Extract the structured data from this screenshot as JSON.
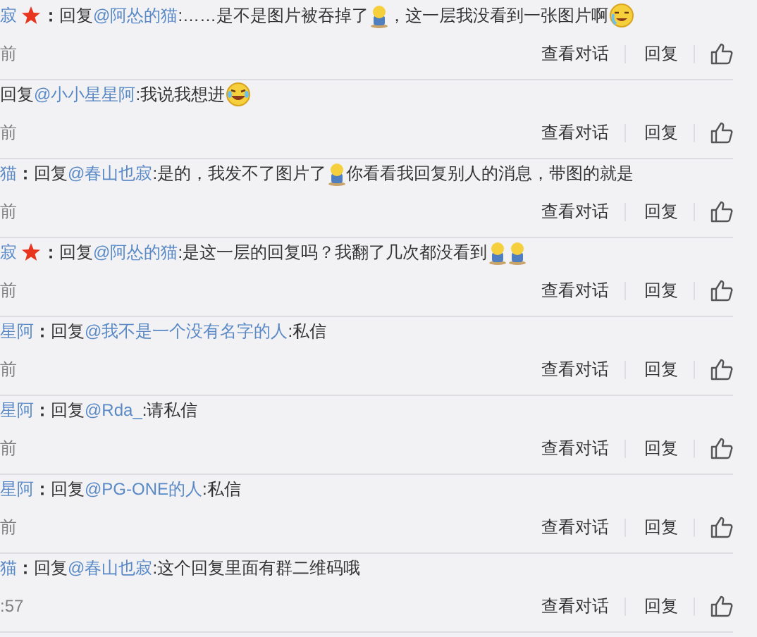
{
  "comments": [
    {
      "author": "寂",
      "starred": true,
      "separator": "：",
      "reply_label": "回复",
      "mention": "@阿怂的猫",
      "body": [
        {
          "kind": "text",
          "text": ":……是不是图片被吞掉了"
        },
        {
          "kind": "figure"
        },
        {
          "kind": "text",
          "text": "，这一层我没看到一张图片啊"
        },
        {
          "kind": "sob"
        }
      ],
      "time": "前",
      "actions": [
        "查看对话",
        "回复"
      ]
    },
    {
      "starred": false,
      "reply_label": "回复",
      "mention": "@小小星星阿",
      "body": [
        {
          "kind": "text",
          "text": ":我说我想进"
        },
        {
          "kind": "laugh"
        }
      ],
      "time": "前",
      "actions": [
        "查看对话",
        "回复"
      ]
    },
    {
      "author": "猫",
      "starred": false,
      "separator": "：",
      "reply_label": "回复",
      "mention": "@春山也寂",
      "body": [
        {
          "kind": "text",
          "text": ":是的，我发不了图片了"
        },
        {
          "kind": "figure"
        },
        {
          "kind": "text",
          "text": " 你看看我回复别人的消息，带图的就是"
        }
      ],
      "time": "前",
      "actions": [
        "查看对话",
        "回复"
      ]
    },
    {
      "author": "寂",
      "starred": true,
      "separator": "：",
      "reply_label": "回复",
      "mention": "@阿怂的猫",
      "body": [
        {
          "kind": "text",
          "text": ":是这一层的回复吗？我翻了几次都没看到"
        },
        {
          "kind": "figure"
        },
        {
          "kind": "figure"
        }
      ],
      "time": "前",
      "actions": [
        "查看对话",
        "回复"
      ]
    },
    {
      "author": "星阿",
      "starred": false,
      "separator": "：",
      "reply_label": "回复",
      "mention": "@我不是一个没有名字的人",
      "body": [
        {
          "kind": "text",
          "text": ":私信"
        }
      ],
      "time": "前",
      "actions": [
        "查看对话",
        "回复"
      ]
    },
    {
      "author": "星阿",
      "starred": false,
      "separator": "：",
      "reply_label": "回复",
      "mention": "@Rda_",
      "body": [
        {
          "kind": "text",
          "text": ":请私信"
        }
      ],
      "time": "前",
      "actions": [
        "查看对话",
        "回复"
      ]
    },
    {
      "author": "星阿",
      "starred": false,
      "separator": "：",
      "reply_label": "回复",
      "mention": "@PG-ONE的人",
      "body": [
        {
          "kind": "text",
          "text": ":私信"
        }
      ],
      "time": "前",
      "actions": [
        "查看对话",
        "回复"
      ]
    },
    {
      "author": "猫",
      "starred": false,
      "separator": "：",
      "reply_label": "回复",
      "mention": "@春山也寂",
      "body": [
        {
          "kind": "text",
          "text": ":这个回复里面有群二维码哦"
        }
      ],
      "time": ":57",
      "actions": [
        "查看对话",
        "回复"
      ]
    }
  ]
}
